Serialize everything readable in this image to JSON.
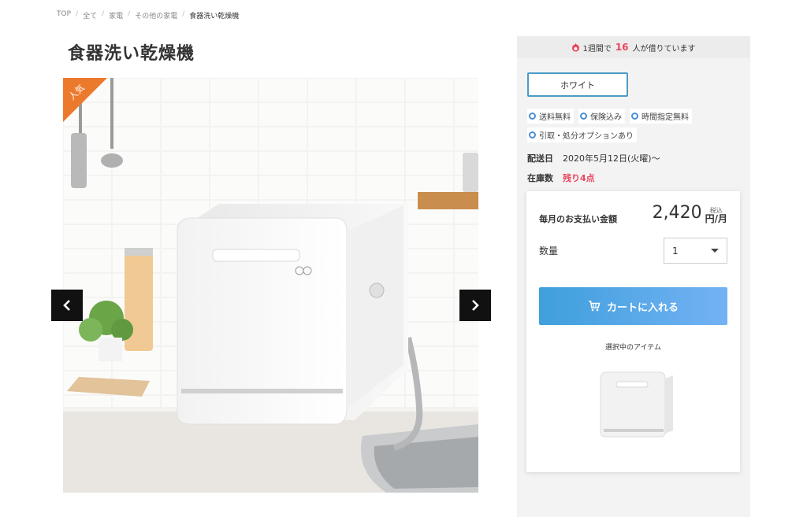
{
  "breadcrumb": {
    "items": [
      "TOP",
      "全て",
      "家電",
      "その他の家電"
    ],
    "current": "食器洗い乾燥機"
  },
  "product": {
    "title": "食器洗い乾燥機",
    "badge": "人気"
  },
  "sidebar": {
    "rent_prefix": "1週間で",
    "rent_count": "16",
    "rent_suffix": "人が借りています",
    "color_option": "ホワイト",
    "features": [
      "送料無料",
      "保険込み",
      "時間指定無料",
      "引取・処分オプションあり"
    ],
    "delivery_label": "配送日",
    "delivery_value": "2020年5月12日(火曜)〜",
    "stock_label": "在庫数",
    "stock_value": "残り4点"
  },
  "purchase": {
    "monthly_label": "毎月のお支払い金額",
    "price": "2,420",
    "tax_label": "税込",
    "unit": "円/月",
    "qty_label": "数量",
    "qty_value": "1",
    "cart_button": "カートに入れる",
    "selected_label": "選択中のアイテム"
  },
  "colors": {
    "accent": "#4a9cc4",
    "badge": "#ec7a2c",
    "highlight": "#e8475f",
    "button_start": "#3f9fdc",
    "button_end": "#73b2f4"
  }
}
